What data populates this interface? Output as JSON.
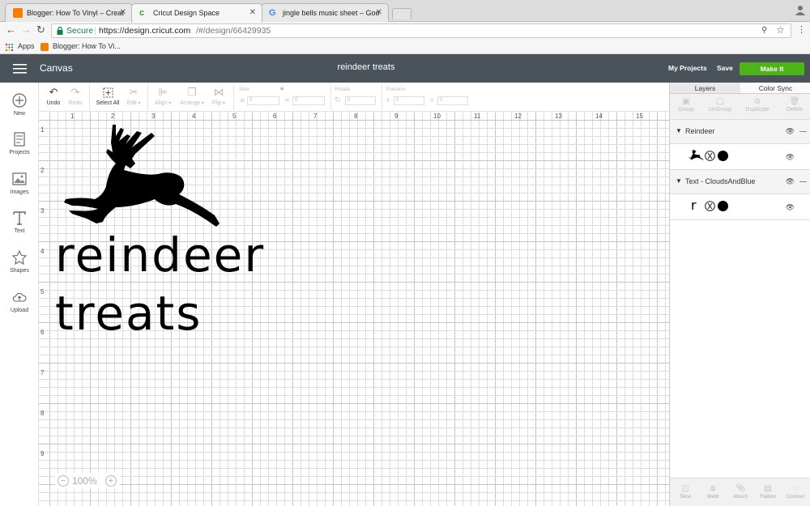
{
  "browser": {
    "tabs": [
      {
        "title": "Blogger: How To Vinyl – Creat",
        "favicon_color": "#f57d00",
        "active": false
      },
      {
        "title": "Cricut Design Space",
        "favicon_color": "#4caf50",
        "active": true
      },
      {
        "title": "jingle bells music sheet – Goo",
        "favicon_color": "#4285f4",
        "active": false
      }
    ],
    "close_glyph": "✕",
    "secure_label": "Secure",
    "url_host": "https://design.cricut.com",
    "url_path": "/#/design/66429935",
    "bookmarks": {
      "apps_label": "Apps",
      "blogger_label": "Blogger: How To Vi..."
    }
  },
  "header": {
    "canvas_label": "Canvas",
    "project_title": "reindeer treats",
    "my_projects_label": "My Projects",
    "save_label": "Save",
    "make_it_label": "Make It"
  },
  "sidebar": {
    "items": [
      {
        "label": "New",
        "icon": "plus-circle-icon"
      },
      {
        "label": "Projects",
        "icon": "projects-icon"
      },
      {
        "label": "Images",
        "icon": "image-icon"
      },
      {
        "label": "Text",
        "icon": "text-icon"
      },
      {
        "label": "Shapes",
        "icon": "shapes-icon"
      },
      {
        "label": "Upload",
        "icon": "upload-cloud-icon"
      }
    ]
  },
  "toolbar": {
    "undo_label": "Undo",
    "redo_label": "Redo",
    "select_all_label": "Select All",
    "edit_label": "Edit",
    "align_label": "Align",
    "arrange_label": "Arrange",
    "flip_label": "Flip",
    "size_label": "Size",
    "w_label": "W",
    "h_label": "H",
    "w_value": "0",
    "h_value": "0",
    "rotate_label": "Rotate",
    "rotate_value": "0",
    "position_label": "Position",
    "x_label": "X",
    "y_label": "Y",
    "x_value": "0",
    "y_value": "0"
  },
  "canvas": {
    "ruler_x": [
      "1",
      "2",
      "3",
      "4",
      "5",
      "6",
      "7",
      "8",
      "9",
      "10",
      "11",
      "12",
      "13",
      "14",
      "15"
    ],
    "ruler_y": [
      "1",
      "2",
      "3",
      "4",
      "5",
      "6",
      "7",
      "8",
      "9"
    ],
    "text_line1": "reindeer",
    "text_line2": "treats",
    "zoom_label": "100%",
    "zoom_out_glyph": "−",
    "zoom_in_glyph": "+"
  },
  "panel": {
    "tabs": [
      "Layers",
      "Color Sync"
    ],
    "tools": [
      "Group",
      "UnGroup",
      "Duplicate",
      "Delete"
    ],
    "layers": [
      {
        "name": "Reindeer",
        "thumb_text": ""
      },
      {
        "name": "Text - CloudsAndBlue",
        "thumb_text": "r"
      }
    ],
    "bottom_tools": [
      "Slice",
      "Weld",
      "Attach",
      "Flatten",
      "Contour"
    ]
  },
  "colors": {
    "topbar": "#4a535a",
    "make_it": "#4db317",
    "grid_line": "#dcdcdc",
    "grid_major": "#c4c4c4"
  }
}
